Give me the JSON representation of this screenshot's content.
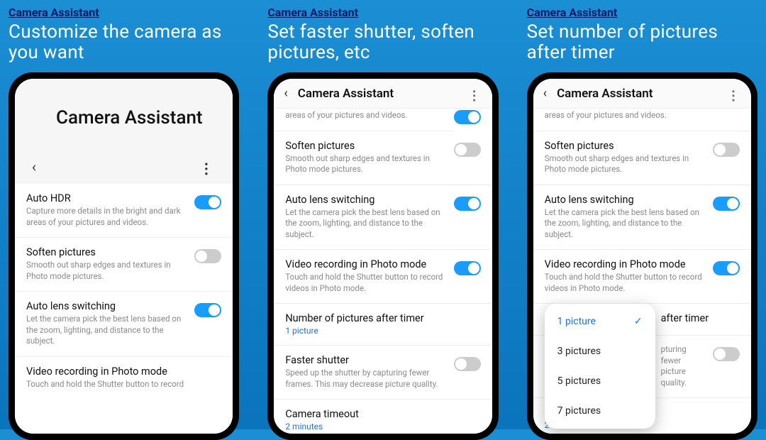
{
  "brand": "Camera Assistant",
  "headlines": {
    "h1": "Customize the camera as you want",
    "h2": "Set faster shutter, soften pictures, etc",
    "h3": "Set number of pictures after timer"
  },
  "appTitle": "Camera Assistant",
  "settings": {
    "autoHdr": {
      "title": "Auto HDR",
      "desc": "Capture more details in the bright and dark areas of your pictures and videos."
    },
    "soften": {
      "title": "Soften pictures",
      "desc": "Smooth out sharp edges and textures in Photo mode pictures."
    },
    "autoLens": {
      "title": "Auto lens switching",
      "desc": "Let the camera pick the best lens based on the zoom, lighting, and distance to the subject."
    },
    "videoPhoto": {
      "title": "Video recording in Photo mode",
      "desc": "Touch and hold the Shutter button to record videos in Photo mode.",
      "descPartial": "Touch and hold the Shutter button to record"
    },
    "numPics": {
      "title": "Number of pictures after timer",
      "value": "1 picture",
      "titleTrail": "after timer"
    },
    "faster": {
      "title": "Faster shutter",
      "desc": "Speed up the shutter by capturing fewer frames. This may decrease picture quality.",
      "descTrailA": "pturing fewer",
      "descTrailB": "picture quality."
    },
    "timeout": {
      "title": "Camera timeout",
      "value": "2 minutes"
    },
    "hdrTrail": "areas of your pictures and videos."
  },
  "popup": {
    "o1": "1 picture",
    "o2": "3 pictures",
    "o3": "5 pictures",
    "o4": "7 pictures"
  }
}
